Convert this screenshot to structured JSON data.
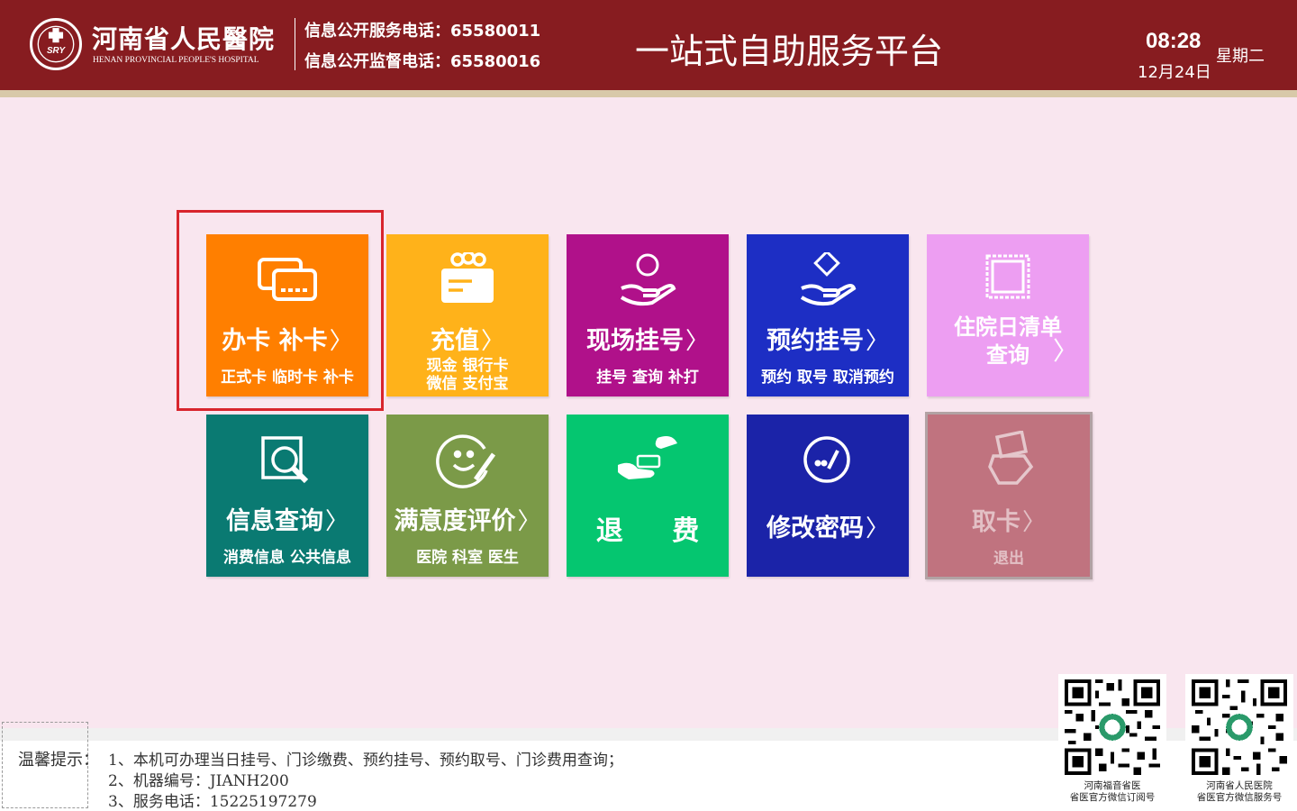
{
  "header": {
    "hospital_name_cn": "河南省人民醫院",
    "hospital_name_en": "HENAN PROVINCIAL PEOPLE'S HOSPITAL",
    "service_phone": "信息公开服务电话：65580011",
    "supervise_phone": "信息公开监督电话：65580016",
    "platform_title": "一站式自助服务平台",
    "time": "08:28",
    "date": "12月24日",
    "weekday": "星期二",
    "colors": {
      "bar": "#871c20",
      "strip": "#d8c9a9"
    }
  },
  "tiles": [
    {
      "title": "办卡 补卡",
      "sub": "正式卡  临时卡  补卡",
      "color": "#ff7f00",
      "icon": "card-icon"
    },
    {
      "title": "充值",
      "sub_line1": "现金  银行卡",
      "sub_line2": "微信  支付宝",
      "color": "#ffb21a",
      "icon": "recharge-icon"
    },
    {
      "title": "现场挂号",
      "sub": "挂号  查询  补打",
      "color": "#b0118a",
      "icon": "register-hand-icon"
    },
    {
      "title": "预约挂号",
      "sub": "预约  取号  取消预约",
      "color": "#1d2ec4",
      "icon": "appointment-hand-icon"
    },
    {
      "title_line1": "住院日清单",
      "title_line2": "查询",
      "color": "#ed9ef2",
      "icon": "inpatient-list-icon"
    },
    {
      "title": "信息查询",
      "sub": "消费信息  公共信息",
      "color": "#0a7a72",
      "icon": "magnifier-icon"
    },
    {
      "title": "满意度评价",
      "sub": "医院 科室 医生",
      "color": "#7b9a48",
      "icon": "smiley-pen-icon"
    },
    {
      "title": "退  费",
      "color": "#05c670",
      "icon": "refund-hands-icon"
    },
    {
      "title": "修改密码",
      "color": "#1b23a8",
      "icon": "password-edit-icon"
    },
    {
      "title": "取卡",
      "sub": "退出",
      "color": "#c0737f",
      "icon": "eject-card-icon"
    }
  ],
  "footer": {
    "tip_label": "温馨提示：",
    "tips": [
      "1、本机可办理当日挂号、门诊缴费、预约挂号、预约取号、门诊费用查询；",
      "2、机器编号：JIANH200",
      "3、服务电话：15225197279"
    ],
    "qr_codes": [
      {
        "caption_line1": "河南福音省医",
        "caption_line2": "省医官方微信订阅号"
      },
      {
        "caption_line1": "河南省人民医院",
        "caption_line2": "省医官方微信服务号"
      }
    ]
  }
}
